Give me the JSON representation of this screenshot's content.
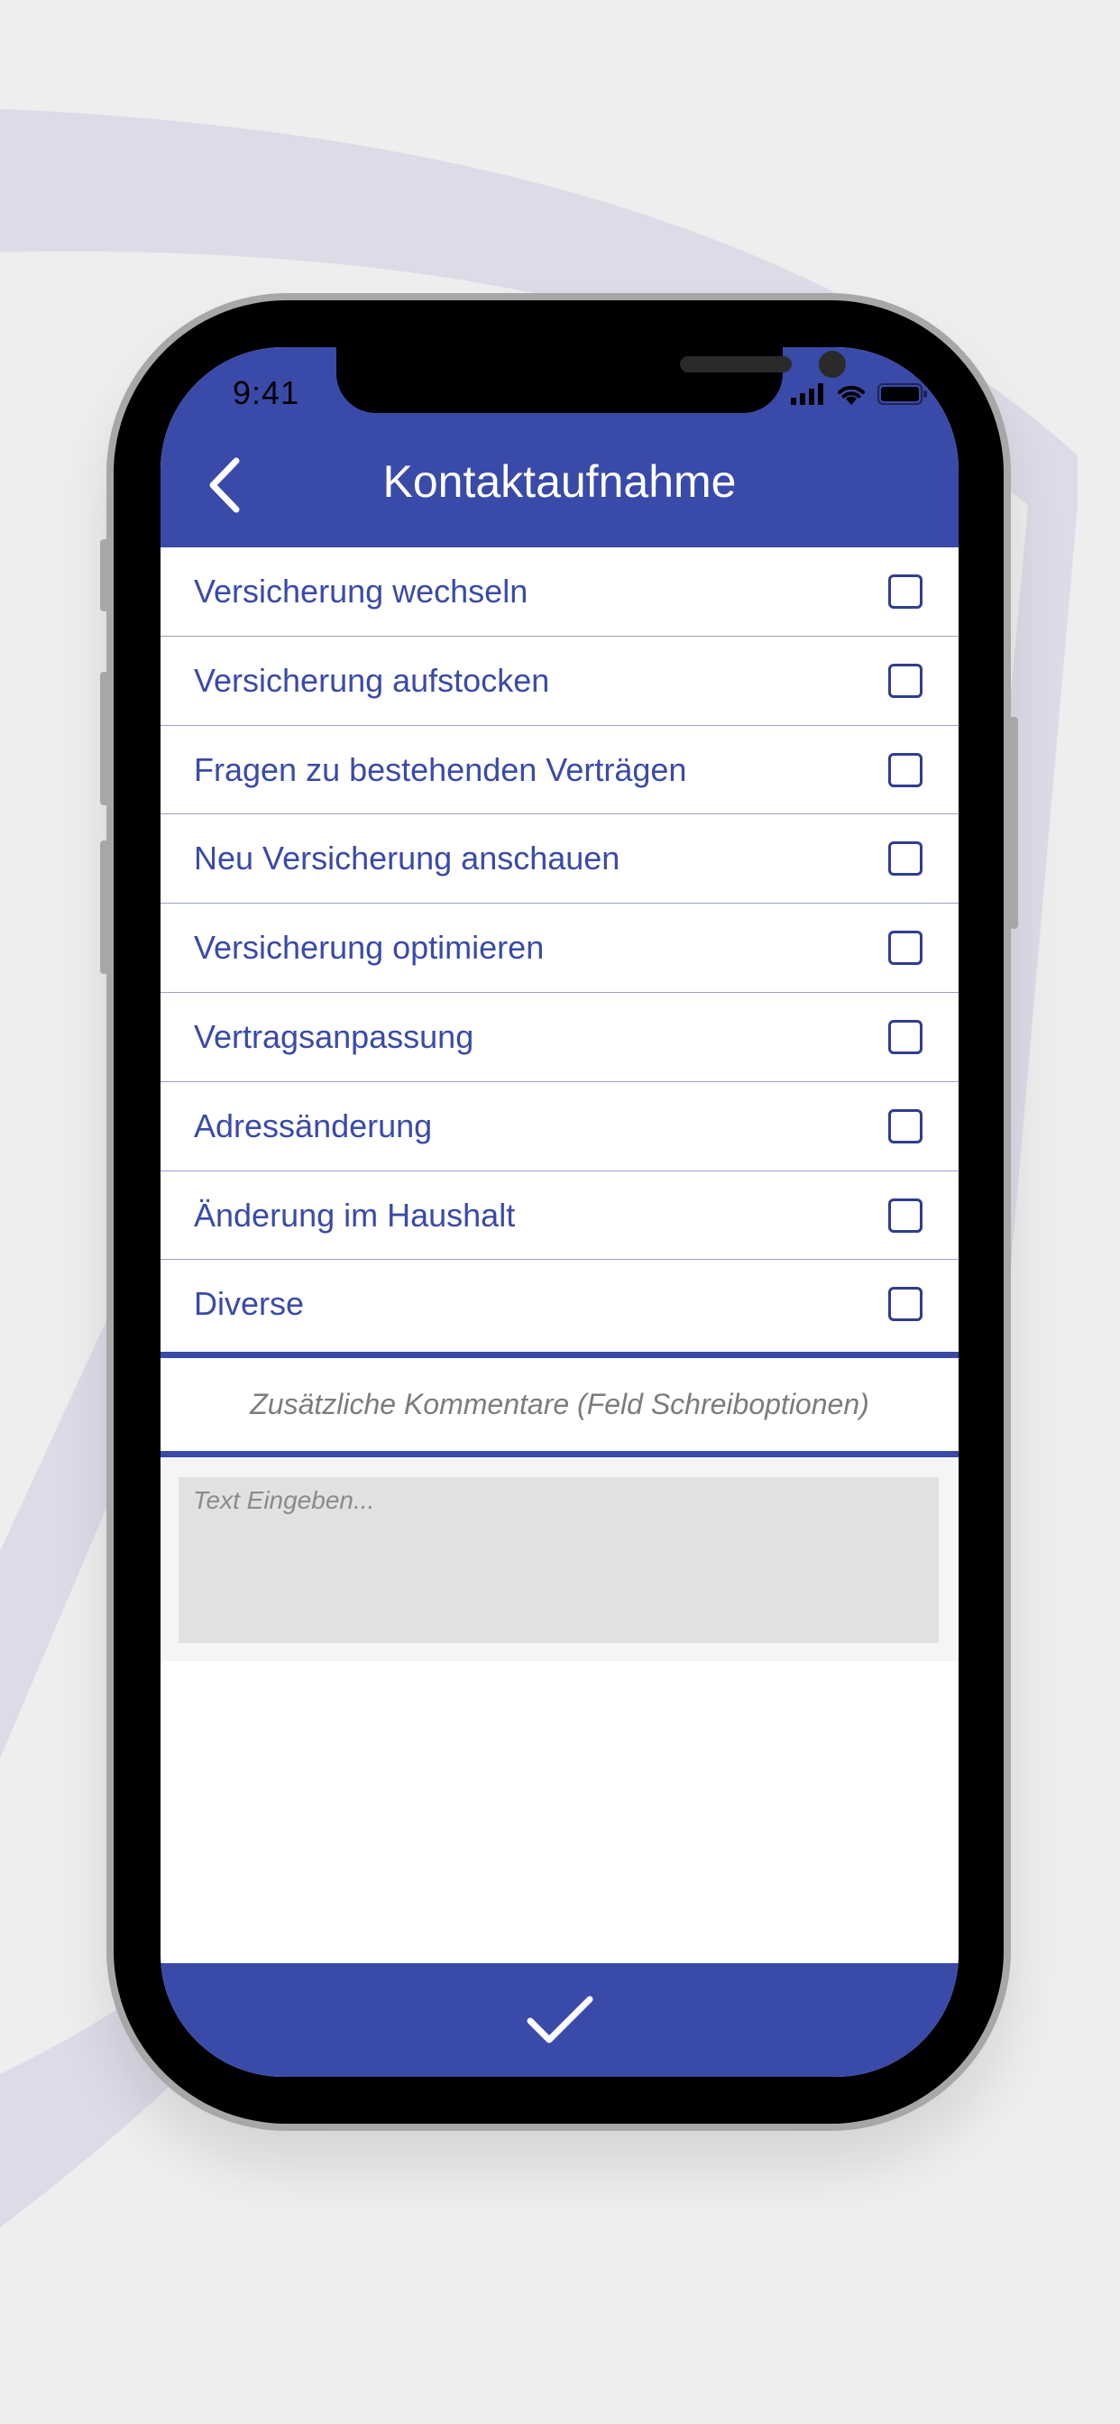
{
  "status_bar": {
    "time": "9:41",
    "icons": [
      "signal-icon",
      "wifi-icon",
      "battery-icon"
    ]
  },
  "header": {
    "title": "Kontaktaufnahme",
    "back_icon": "chevron-left-icon"
  },
  "options": [
    {
      "label": "Versicherung wechseln",
      "checked": false
    },
    {
      "label": "Versicherung aufstocken",
      "checked": false
    },
    {
      "label": "Fragen zu bestehenden Verträgen",
      "checked": false
    },
    {
      "label": "Neu Versicherung anschauen",
      "checked": false
    },
    {
      "label": "Versicherung optimieren",
      "checked": false
    },
    {
      "label": "Vertragsanpassung",
      "checked": false
    },
    {
      "label": "Adressänderung",
      "checked": false
    },
    {
      "label": "Änderung im Haushalt",
      "checked": false
    },
    {
      "label": "Diverse",
      "checked": false
    }
  ],
  "comments": {
    "heading": "Zusätzliche Kommentare (Feld Schreiboptionen)",
    "placeholder": "Text Eingeben...",
    "value": ""
  },
  "footer": {
    "confirm_icon": "checkmark-icon"
  },
  "colors": {
    "accent": "#3a4aa8",
    "background": "#eeeeee",
    "swoosh": "#dcdce8",
    "comment_field": "#e1e1e1"
  }
}
